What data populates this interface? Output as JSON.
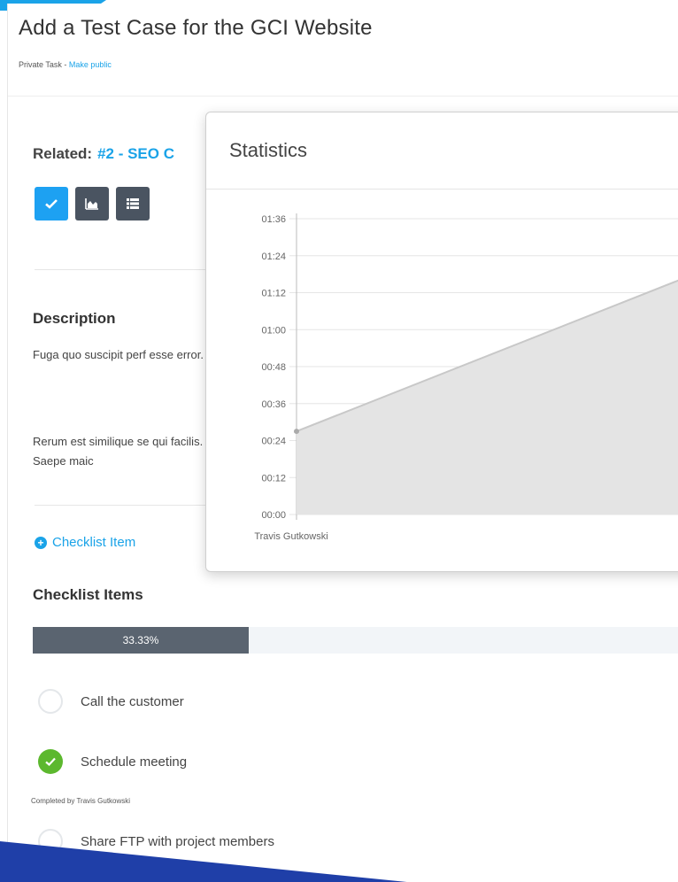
{
  "task": {
    "title": "Add a Test Case for the GCI Website",
    "privacy": "Private Task",
    "separator": " - ",
    "make_public": "Make public"
  },
  "related": {
    "label": "Related:",
    "link": "#2 - SEO C"
  },
  "toolbar": {
    "buttons": [
      {
        "icon": "check-icon"
      },
      {
        "icon": "area-chart-icon"
      },
      {
        "icon": "list-icon"
      }
    ],
    "accent_color": "#1da1f2",
    "button_color": "#4a5461"
  },
  "description": {
    "title": "Description",
    "p1": "Fuga quo suscipit perf esse error.",
    "p2": "Rerum est similique se qui facilis. Saepe maic"
  },
  "checklist": {
    "add_label": "Checklist Item",
    "title": "Checklist Items",
    "progress": 0.3333,
    "progress_label": "33.33%",
    "items": [
      {
        "label": "Call the customer",
        "done": false
      },
      {
        "label": "Schedule meeting",
        "done": true,
        "completed_by": "Completed by Travis Gutkowski"
      },
      {
        "label": "Share FTP with project members",
        "done": false
      }
    ],
    "done_color": "#5cb82e"
  },
  "statistics": {
    "title": "Statistics"
  },
  "chart_data": {
    "type": "area",
    "categories": [
      "Travis Gutkowski"
    ],
    "y_ticks": [
      "00:00",
      "00:12",
      "00:24",
      "00:36",
      "00:48",
      "01:00",
      "01:12",
      "01:24",
      "01:36"
    ],
    "y_unit": "minutes",
    "ylim": [
      0,
      96
    ],
    "series": [
      {
        "values": [
          27
        ]
      }
    ],
    "grid": true
  }
}
